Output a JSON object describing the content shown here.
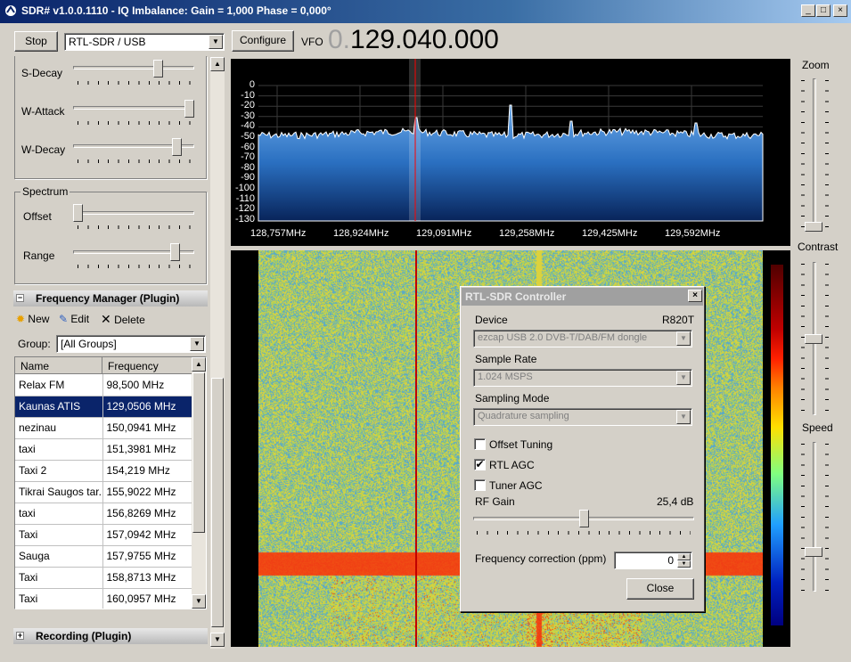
{
  "window": {
    "title": "SDR# v1.0.0.1110 - IQ Imbalance: Gain = 1,000 Phase = 0,000°",
    "minimize_label": "_",
    "maximize_label": "□",
    "close_label": "×"
  },
  "toolbar": {
    "stop_label": "Stop",
    "device_select": "RTL-SDR / USB",
    "configure_label": "Configure",
    "vfo_label": "VFO",
    "vfo_prefix": "0.",
    "vfo_frequency": "129.040.000"
  },
  "left_panel": {
    "agc_sliders": [
      {
        "label": "S-Decay",
        "level": 0.72
      },
      {
        "label": "W-Attack",
        "level": 1.0
      },
      {
        "label": "W-Decay",
        "level": 0.89
      }
    ],
    "spectrum_group": {
      "title": "Spectrum",
      "offset_label": "Offset",
      "offset_level": 0.0,
      "range_label": "Range",
      "range_level": 0.87
    },
    "freq_manager": {
      "title": "Frequency Manager (Plugin)",
      "new_label": "New",
      "edit_label": "Edit",
      "delete_label": "Delete",
      "group_label": "Group:",
      "group_value": "[All Groups]",
      "columns": [
        "Name",
        "Frequency"
      ],
      "rows": [
        {
          "name": "Relax FM",
          "freq": "98,500 MHz"
        },
        {
          "name": "Kaunas ATIS",
          "freq": "129,0506 MHz",
          "selected": true
        },
        {
          "name": "nezinau",
          "freq": "150,0941 MHz"
        },
        {
          "name": "taxi",
          "freq": "151,3981 MHz"
        },
        {
          "name": "Taxi 2",
          "freq": "154,219 MHz"
        },
        {
          "name": "Tikrai Saugos tar...",
          "freq": "155,9022 MHz"
        },
        {
          "name": "taxi",
          "freq": "156,8269 MHz"
        },
        {
          "name": "Taxi",
          "freq": "157,0942 MHz"
        },
        {
          "name": "Sauga",
          "freq": "157,9755 MHz"
        },
        {
          "name": "Taxi",
          "freq": "158,8713 MHz"
        },
        {
          "name": "Taxi",
          "freq": "160,0957 MHz"
        }
      ]
    },
    "recording": {
      "title": "Recording (Plugin)"
    }
  },
  "spectrum": {
    "y_ticks": [
      "0",
      "-10",
      "-20",
      "-30",
      "-40",
      "-50",
      "-60",
      "-70",
      "-80",
      "-90",
      "-100",
      "-110",
      "-120",
      "-130"
    ],
    "x_ticks": [
      "128,757MHz",
      "128,924MHz",
      "129,091MHz",
      "129,258MHz",
      "129,425MHz",
      "129,592MHz"
    ]
  },
  "right_panel": {
    "zoom_label": "Zoom",
    "zoom_level": 0.0,
    "contrast_label": "Contrast",
    "contrast_level": 0.5,
    "speed_label": "Speed",
    "speed_level": 0.25
  },
  "rtl_dialog": {
    "title": "RTL-SDR Controller",
    "close_label": "×",
    "device_label": "Device",
    "device_tuner": "R820T",
    "device_value": "ezcap USB 2.0 DVB-T/DAB/FM dongle",
    "sample_rate_label": "Sample Rate",
    "sample_rate_value": "1.024 MSPS",
    "sampling_mode_label": "Sampling Mode",
    "sampling_mode_value": "Quadrature sampling",
    "offset_tuning_label": "Offset Tuning",
    "offset_tuning_checked": false,
    "rtl_agc_label": "RTL AGC",
    "rtl_agc_checked": true,
    "tuner_agc_label": "Tuner AGC",
    "tuner_agc_checked": false,
    "rf_gain_label": "RF Gain",
    "rf_gain_value": "25,4 dB",
    "rf_gain_level": 0.5,
    "freq_corr_label": "Frequency correction (ppm)",
    "freq_corr_value": "0",
    "close_button_label": "Close"
  },
  "colors": {
    "title_start": "#0a246a",
    "selection": "#0a246a",
    "spectrum_fill": "#2a6fc0",
    "tuned_line": "#ff0000"
  }
}
